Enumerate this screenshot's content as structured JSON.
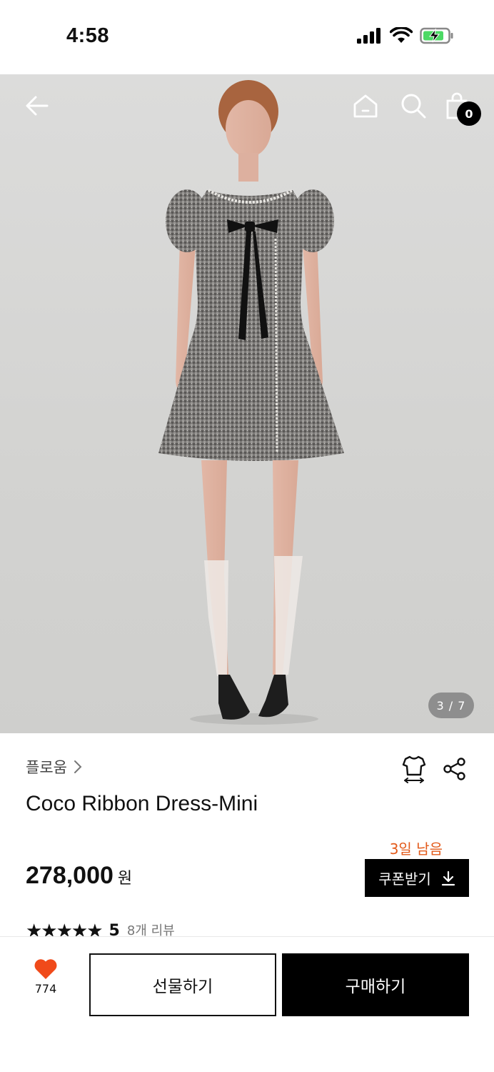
{
  "status_bar": {
    "time": "4:58"
  },
  "top_nav": {
    "cart_count": "0"
  },
  "gallery": {
    "counter": "3 / 7",
    "current_index": 3,
    "total": 7
  },
  "product": {
    "brand": "플로움",
    "title": "Coco Ribbon Dress-Mini",
    "price": "278,000",
    "currency": "원",
    "coupon_remaining": "3일 남음",
    "coupon_label": "쿠폰받기",
    "rating_stars": "★★★★★",
    "rating_score": "5",
    "review_count": "8개 리뷰"
  },
  "bottom_bar": {
    "like_count": "774",
    "gift_label": "선물하기",
    "buy_label": "구매하기"
  },
  "colors": {
    "accent": "#e35a1a",
    "like": "#f04a1a",
    "primary": "#000000"
  }
}
